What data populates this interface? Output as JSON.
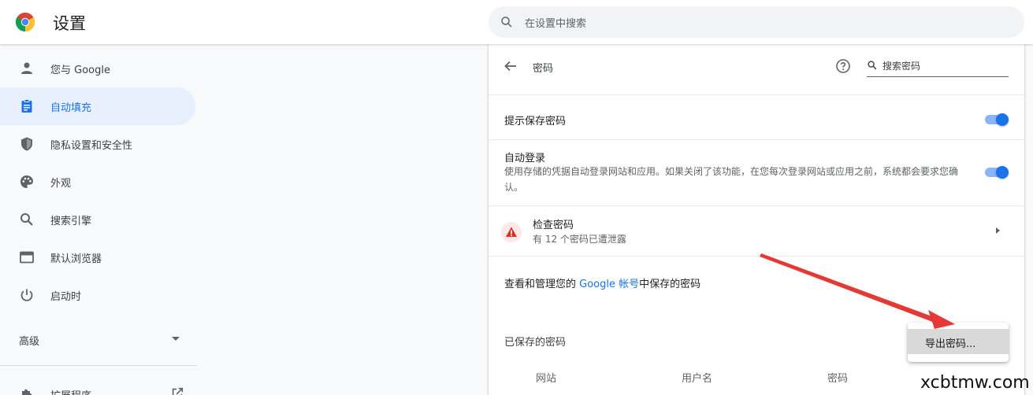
{
  "header": {
    "title": "设置",
    "search_placeholder": "在设置中搜索"
  },
  "sidebar": {
    "items": [
      {
        "label": "您与 Google",
        "icon": "person-icon"
      },
      {
        "label": "自动填充",
        "icon": "autofill-clipboard-icon",
        "active": true
      },
      {
        "label": "隐私设置和安全性",
        "icon": "shield-icon"
      },
      {
        "label": "外观",
        "icon": "palette-icon"
      },
      {
        "label": "搜索引擎",
        "icon": "search-icon"
      },
      {
        "label": "默认浏览器",
        "icon": "browser-window-icon"
      },
      {
        "label": "启动时",
        "icon": "power-icon"
      }
    ],
    "advanced": "高级",
    "extensions": "扩展程序"
  },
  "passwords": {
    "title": "密码",
    "search_placeholder": "搜索密码",
    "offer_to_save": "提示保存密码",
    "auto_signin": "自动登录",
    "auto_signin_desc": "使用存储的凭据自动登录网站和应用。如果关闭了该功能，在您每次登录网站或应用之前，系统都会要求您确认。",
    "check_title": "检查密码",
    "check_desc": "有 12 个密码已遭泄露",
    "manage_prefix": "查看和管理您的 ",
    "manage_link": "Google 帐号",
    "manage_suffix": "中保存的密码",
    "saved_title": "已保存的密码",
    "columns": [
      "网站",
      "用户名",
      "密码"
    ]
  },
  "menu": {
    "export_label": "导出密码..."
  },
  "watermark": "xcbtmw.com",
  "colors": {
    "accent": "#1a73e8",
    "active_bg": "#e8f0fe",
    "warning": "#d93025",
    "annotation_arrow": "#e53935"
  }
}
